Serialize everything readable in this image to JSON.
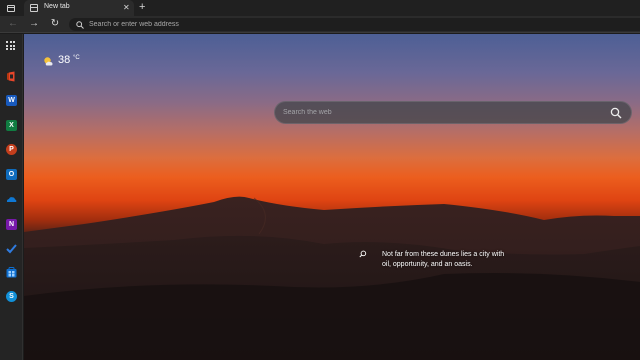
{
  "tabstrip": {
    "active_tab": {
      "title": "New tab",
      "close_glyph": "✕",
      "favicon": "new-tab-page-icon"
    },
    "new_tab_glyph": "+"
  },
  "toolbar": {
    "back_glyph": "←",
    "forward_glyph": "→",
    "refresh_glyph": "↻",
    "address_placeholder": "Search or enter web address"
  },
  "sidebar": {
    "apps": [
      {
        "name": "office",
        "letter": "",
        "color": "#d83b01"
      },
      {
        "name": "word",
        "letter": "W",
        "color": "#185abd"
      },
      {
        "name": "excel",
        "letter": "X",
        "color": "#107c41"
      },
      {
        "name": "powerpoint",
        "letter": "P",
        "color": "#c43e1c"
      },
      {
        "name": "outlook",
        "letter": "O",
        "color": "#0f6cbd"
      },
      {
        "name": "onedrive",
        "letter": "",
        "color": "#0f78d4"
      },
      {
        "name": "onenote",
        "letter": "N",
        "color": "#7719aa"
      },
      {
        "name": "to-do",
        "letter": "",
        "color": "#2f7ce0"
      },
      {
        "name": "windows-store",
        "letter": "",
        "color": "#0f6fd0"
      },
      {
        "name": "skype",
        "letter": "S",
        "color": "#1190d8"
      }
    ]
  },
  "weather": {
    "temperature": "38",
    "unit": "°C",
    "condition_icon": "partly-sunny-icon"
  },
  "search": {
    "placeholder": "Search the web"
  },
  "image_info": {
    "text": "Not far from these dunes lies a city with oil, opportunity, and an oasis."
  },
  "colors": {
    "sky_top": "#4d5f95",
    "sunset_orange": "#ec5e1e",
    "dunes": "#1a1211"
  }
}
